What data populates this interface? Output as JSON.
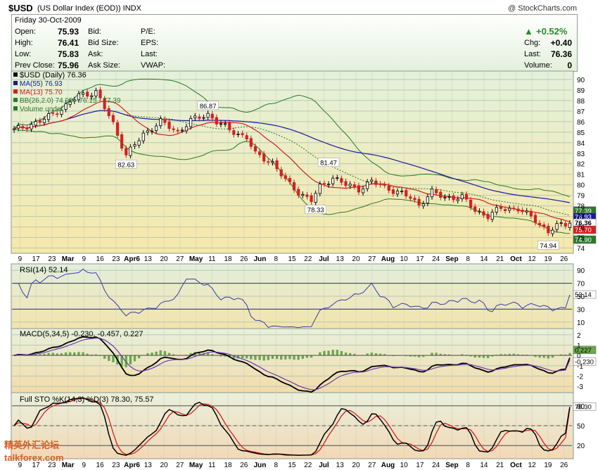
{
  "header": {
    "symbol": "$USD",
    "description": "(US Dollar Index (EOD))",
    "exchange": "INDX",
    "copyright": "@ StockCharts.com"
  },
  "info": {
    "date_line": "Friday  30-Oct-2009",
    "open_label": "Open:",
    "open": "75.93",
    "high_label": "High:",
    "high": "76.41",
    "low_label": "Low:",
    "low": "75.83",
    "prev_label": "Prev Close:",
    "prev": "75.96",
    "bid": "Bid:",
    "bid_size": "Bid Size:",
    "ask": "Ask:",
    "ask_size": "Ask Size:",
    "pe": "P/E:",
    "eps": "EPS:",
    "last_label": "Last:",
    "vwap": "VWAP:",
    "pct": "+0.52%",
    "chg_label": "Chg:",
    "chg": "+0.40",
    "last2_label": "Last:",
    "last": "76.36",
    "vol_label": "Volume:",
    "vol": "0"
  },
  "legend": {
    "main": "$USD (Daily) 76.36",
    "ma55": "MA(55) 76.93",
    "ma13": "MA(13) 75.70",
    "bb": "BB(26,2.0) 74.90 - 76.15 - 77.39",
    "vol": "Volume undef"
  },
  "colors": {
    "ma55": "#1a1a9c",
    "ma13": "#d42020",
    "bb": "#2a7a2a",
    "up": "#000000",
    "down": "#d42020"
  },
  "watermark": {
    "cn": "精英外汇论坛",
    "url": "talkforex.com"
  },
  "chart_data": [
    {
      "type": "candlestick",
      "title": "$USD (Daily) 76.36",
      "x_ticks": [
        "9",
        "17",
        "23",
        "Mar",
        "9",
        "16",
        "23",
        "Apr6",
        "13",
        "20",
        "27",
        "May",
        "11",
        "18",
        "26",
        "Jun",
        "8",
        "15",
        "22",
        "Jul",
        "13",
        "20",
        "27",
        "Aug",
        "10",
        "17",
        "24",
        "Sep",
        "8",
        "14",
        "21",
        "Oct",
        "12",
        "19",
        "26"
      ],
      "y_ticks": [
        74,
        75,
        76,
        77,
        78,
        79,
        80,
        81,
        82,
        83,
        84,
        85,
        86,
        87,
        88,
        89,
        90
      ],
      "ylim": [
        73.5,
        90.8
      ],
      "close_path": [
        [
          0,
          85.2
        ],
        [
          6,
          86.0
        ],
        [
          12,
          87.5
        ],
        [
          15,
          88.5
        ],
        [
          19,
          88.8
        ],
        [
          23,
          85.8
        ],
        [
          26,
          82.8
        ],
        [
          30,
          84.8
        ],
        [
          34,
          86.0
        ],
        [
          38,
          85.0
        ],
        [
          41,
          86.1
        ],
        [
          45,
          86.7
        ],
        [
          47,
          86.0
        ],
        [
          50,
          85.2
        ],
        [
          54,
          84.5
        ],
        [
          56,
          82.9
        ],
        [
          60,
          82.1
        ],
        [
          63,
          80.4
        ],
        [
          66,
          79.3
        ],
        [
          69,
          78.5
        ],
        [
          71,
          79.8
        ],
        [
          74,
          80.7
        ],
        [
          77,
          80.0
        ],
        [
          80,
          79.6
        ],
        [
          83,
          80.3
        ],
        [
          86,
          79.8
        ],
        [
          89,
          79.3
        ],
        [
          92,
          78.8
        ],
        [
          94,
          78.1
        ],
        [
          97,
          79.3
        ],
        [
          100,
          78.8
        ],
        [
          104,
          78.8
        ],
        [
          107,
          77.6
        ],
        [
          110,
          77.0
        ],
        [
          113,
          77.8
        ],
        [
          117,
          77.7
        ],
        [
          121,
          76.7
        ],
        [
          124,
          75.5
        ],
        [
          126,
          76.1
        ],
        [
          129,
          76.4
        ]
      ],
      "annotations": [
        {
          "text": "82.63",
          "x": 26,
          "y": 82.63
        },
        {
          "text": "86.87",
          "x": 45,
          "y": 86.87
        },
        {
          "text": "81.47",
          "x": 73,
          "y": 81.47
        },
        {
          "text": "78.33",
          "x": 70,
          "y": 78.33
        },
        {
          "text": "74.94",
          "x": 124,
          "y": 74.94
        }
      ],
      "right_labels": [
        {
          "text": "77.39",
          "y": 77.39,
          "color": "#2a7a2a"
        },
        {
          "text": "76.93",
          "y": 76.93,
          "color": "#1a1a9c"
        },
        {
          "text": "76.36",
          "y": 76.36,
          "color": "#000000"
        },
        {
          "text": "75.70",
          "y": 75.7,
          "color": "#d42020"
        },
        {
          "text": "74.90",
          "y": 74.9,
          "color": "#2a7a2a"
        }
      ]
    },
    {
      "type": "line",
      "title": "RSI(14) 52.14",
      "y_ticks": [
        10,
        30,
        50,
        70,
        90
      ],
      "ylim": [
        0,
        100
      ],
      "last": "52.14"
    },
    {
      "type": "line",
      "title": "MACD(5,34,5) -0.230, -0.457, 0.227",
      "y_ticks": [
        -3,
        -2,
        -1,
        0,
        1,
        2
      ],
      "ylim": [
        -3.6,
        2.6
      ],
      "right_labels": [
        "0.227",
        "-0.230"
      ]
    },
    {
      "type": "line",
      "title": "Full STO %K(14,3) %D(3) 78.30, 75.57",
      "y_ticks": [
        20,
        50,
        80
      ],
      "ylim": [
        0,
        100
      ],
      "last": "78.30"
    }
  ]
}
